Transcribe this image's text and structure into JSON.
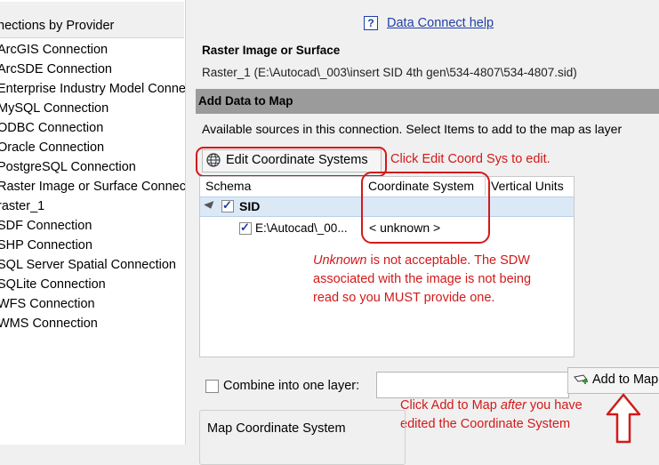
{
  "left_panel": {
    "header": "nections by Provider",
    "items": [
      "ArcGIS Connection",
      "ArcSDE Connection",
      "Enterprise Industry Model Conne",
      "MySQL Connection",
      "ODBC Connection",
      "Oracle Connection",
      "PostgreSQL Connection",
      "Raster Image or Surface Connec",
      "raster_1",
      "SDF Connection",
      "SHP Connection",
      "SQL Server Spatial Connection",
      "SQLite Connection",
      "WFS Connection",
      "WMS Connection"
    ]
  },
  "help": {
    "icon": "?",
    "link": "Data Connect help"
  },
  "raster": {
    "title": "Raster Image or Surface",
    "path": "Raster_1 (E:\\Autocad\\_003\\insert SID 4th gen\\534-4807\\534-4807.sid)"
  },
  "section": {
    "title": "Add Data to Map",
    "description": "Available sources in this connection.  Select Items to add to the map as layer"
  },
  "toolbar": {
    "edit_coord_label": "Edit Coordinate Systems"
  },
  "table": {
    "headers": [
      "Schema",
      "Coordinate System",
      "Vertical Units"
    ],
    "schema_row": "SID",
    "file_row": {
      "name": "E:\\Autocad\\_00...",
      "coord": "< unknown >"
    }
  },
  "footer": {
    "combine_label": "Combine into one layer:",
    "layer_name_value": "",
    "add_to_map_label": "Add to Map",
    "map_coord_label": "Map Coordinate System"
  },
  "annotations": {
    "edit_note": "Click Edit Coord Sys to edit.",
    "unknown_em": "Unknown",
    "unknown_rest": " is not acceptable. The SDW associated with the image is not being read so you MUST provide one.",
    "add_part1": "Click Add to Map ",
    "add_em": "after",
    "add_part2": " you have edited the Coordinate System"
  },
  "colors": {
    "annotation": "#d31919",
    "link": "#1f3fa8",
    "section_bar": "#9b9b9b",
    "row_select": "#dbe9f7"
  }
}
